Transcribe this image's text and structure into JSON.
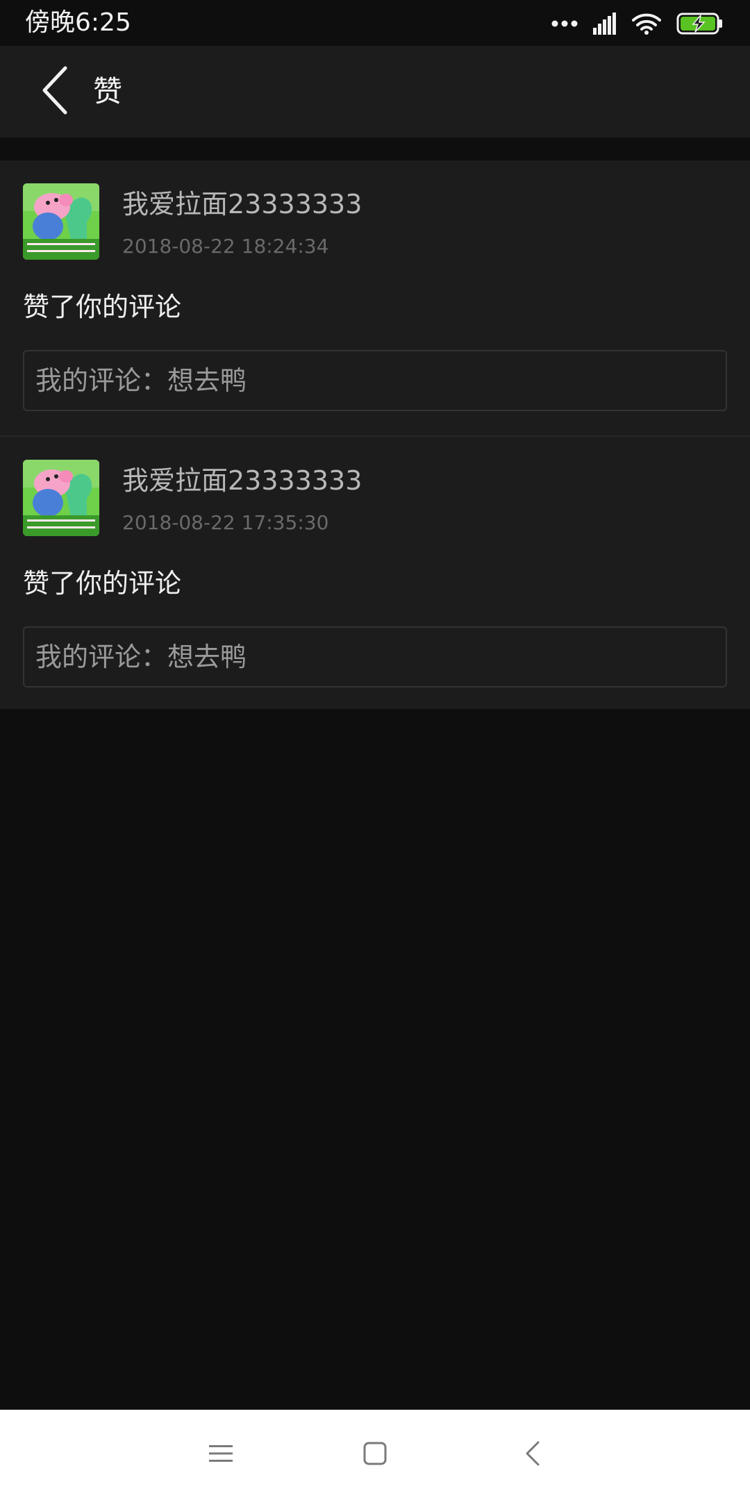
{
  "status_bar": {
    "time": "傍晚6:25",
    "icons": [
      "more-dots-icon",
      "signal-icon",
      "wifi-icon",
      "battery-charging-icon"
    ]
  },
  "header": {
    "title": "赞",
    "back_icon": "back-arrow-icon"
  },
  "notifications": [
    {
      "username": "我爱拉面23333333",
      "timestamp": "2018-08-22 18:24:34",
      "action": "赞了你的评论",
      "comment": "我的评论：想去鸭"
    },
    {
      "username": "我爱拉面23333333",
      "timestamp": "2018-08-22 17:35:30",
      "action": "赞了你的评论",
      "comment": "我的评论：想去鸭"
    }
  ],
  "nav_bar": {
    "icons": [
      "menu-icon",
      "home-icon",
      "back-icon"
    ]
  },
  "colors": {
    "background": "#0e0e0e",
    "surface": "#1d1c1d",
    "battery_accent": "#58c322"
  }
}
